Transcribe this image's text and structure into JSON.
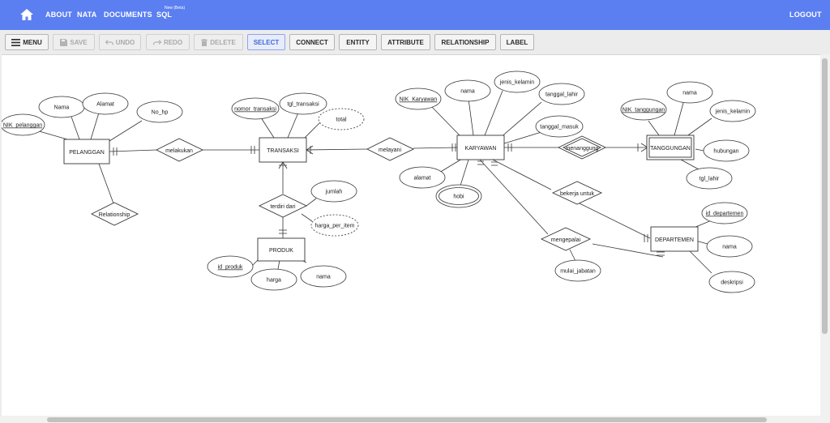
{
  "nav": {
    "about": "ABOUT",
    "nata": "NATA",
    "documents": "DOCUMENTS",
    "sql": "SQL",
    "sql_badge": "New (Beta)",
    "logout": "LOGOUT"
  },
  "toolbar": {
    "menu": "MENU",
    "save": "SAVE",
    "undo": "UNDO",
    "redo": "REDO",
    "delete": "DELETE",
    "select": "SELECT",
    "connect": "CONNECT",
    "entity": "ENTITY",
    "attribute": "ATTRIBUTE",
    "relationship": "RELATIONSHIP",
    "label": "LABEL"
  },
  "colors": {
    "navbar": "#5b7ff1",
    "active_tool": "#4367d6"
  },
  "diagram": {
    "entities": {
      "pelanggan": "PELANGGAN",
      "transaksi": "TRANSAKSI",
      "karyawan": "KARYAWAN",
      "tanggungan": "TANGGUNGAN",
      "produk": "PRODUK",
      "departemen": "DEPARTEMEN"
    },
    "relationships": {
      "melakukan": "melakukan",
      "melayani": "melayani",
      "menanggung": "menanggung",
      "terdiri_dari": "terdiri dari",
      "relationship": "Relationship",
      "bekerja_untuk": "bekerja untuk",
      "mengepalai": "mengepalai"
    },
    "attributes": {
      "nik_pelanggan": "NIK_pelanggan",
      "nama_pelanggan": "Nama",
      "alamat_pelanggan": "Alamat",
      "no_hp": "No_hp",
      "nomor_transaksi": "nomor_transaksi",
      "tgl_transaksi": "tgl_transaksi",
      "total": "total",
      "jumlah": "jumlah",
      "harga_per_item": "harga_per_item",
      "id_produk": "id_produk",
      "harga": "harga",
      "nama_produk": "nama",
      "nik_karyawan": "NIK_Karyawan",
      "nama_karyawan": "nama",
      "jenis_kelamin_karyawan": "jenis_kelamin",
      "tanggal_lahir": "tanggal_lahir",
      "tanggal_masuk": "tanggal_masuk",
      "alamat_karyawan": "alamat",
      "hobi": "hobi",
      "nik_tanggungan": "NIK_tanggungan",
      "nama_tanggungan": "nama",
      "jenis_kelamin_tanggungan": "jenis_kelamin",
      "hubungan": "hubungan",
      "tgl_lahir": "tgl_lahir",
      "id_departemen": "id_departemen",
      "nama_departemen": "nama",
      "deskripsi": "deskripsi",
      "mulai_jabatan": "mulai_jabatan"
    }
  }
}
